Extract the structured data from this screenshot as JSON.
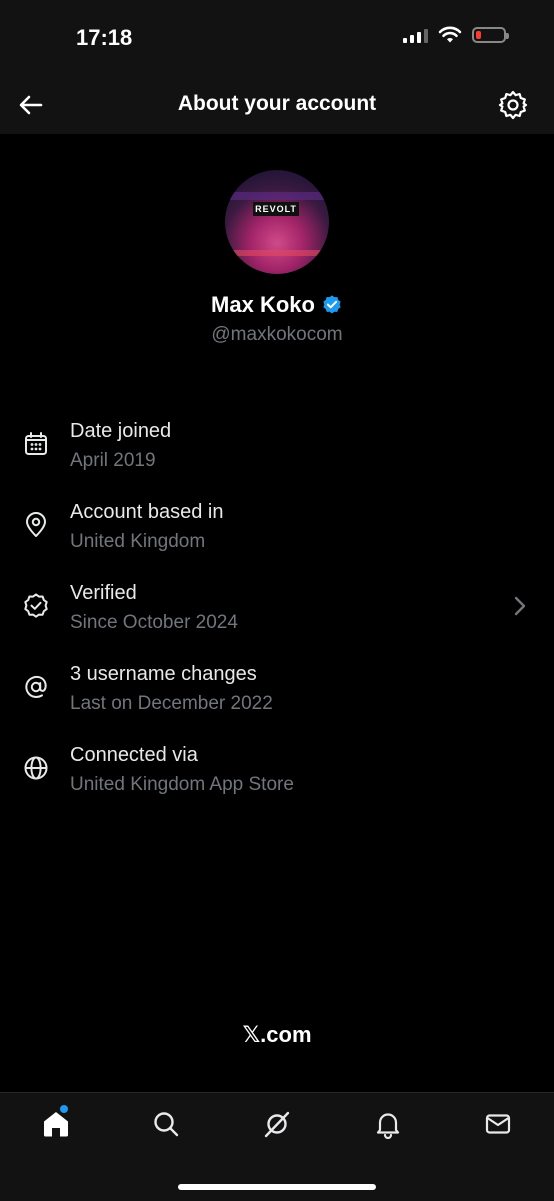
{
  "status_bar": {
    "time": "17:18"
  },
  "header": {
    "title": "About your account"
  },
  "profile": {
    "avatar_sign_text": "REVOLT",
    "name": "Max Koko",
    "handle": "@maxkokocom"
  },
  "info": [
    {
      "icon": "calendar-icon",
      "title": "Date joined",
      "subtitle": "April 2019"
    },
    {
      "icon": "location-pin-icon",
      "title": "Account based in",
      "subtitle": "United Kingdom"
    },
    {
      "icon": "verified-badge-icon",
      "title": "Verified",
      "subtitle": "Since October 2024"
    },
    {
      "icon": "at-sign-icon",
      "title": "3 username changes",
      "subtitle": "Last on December 2022"
    },
    {
      "icon": "globe-icon",
      "title": "Connected via",
      "subtitle": "United Kingdom App Store"
    }
  ],
  "footer": {
    "logo_text": "𝕏.com"
  },
  "tabs": [
    "home-icon",
    "search-icon",
    "grok-icon",
    "bell-icon",
    "mail-icon"
  ],
  "colors": {
    "accent": "#1d9bf0",
    "background": "#000000",
    "secondary_text": "#71767b"
  }
}
